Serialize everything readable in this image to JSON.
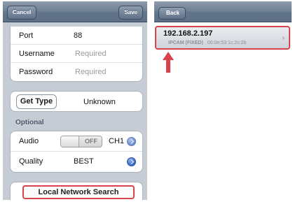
{
  "left": {
    "navbar": {
      "cancel": "Cancel",
      "save": "Save"
    },
    "fields": [
      {
        "label": "Port",
        "value": "88",
        "placeholder": ""
      },
      {
        "label": "Username",
        "value": "",
        "placeholder": "Required"
      },
      {
        "label": "Password",
        "value": "",
        "placeholder": "Required"
      }
    ],
    "get_type": {
      "button": "Get Type",
      "value": "Unknown"
    },
    "optional": {
      "header": "Optional",
      "audio": {
        "label": "Audio",
        "toggle": "OFF",
        "channel": "CH1"
      },
      "quality": {
        "label": "Quality",
        "value": "BEST"
      }
    },
    "search_button": "Local Network Search"
  },
  "right": {
    "navbar": {
      "back": "Back"
    },
    "device": {
      "ip": "192.168.2.197",
      "type": "IPCAM (FIXED)",
      "mac": "00:0e:53:1c:2c:2b"
    },
    "accent_color": "#d9434b"
  }
}
